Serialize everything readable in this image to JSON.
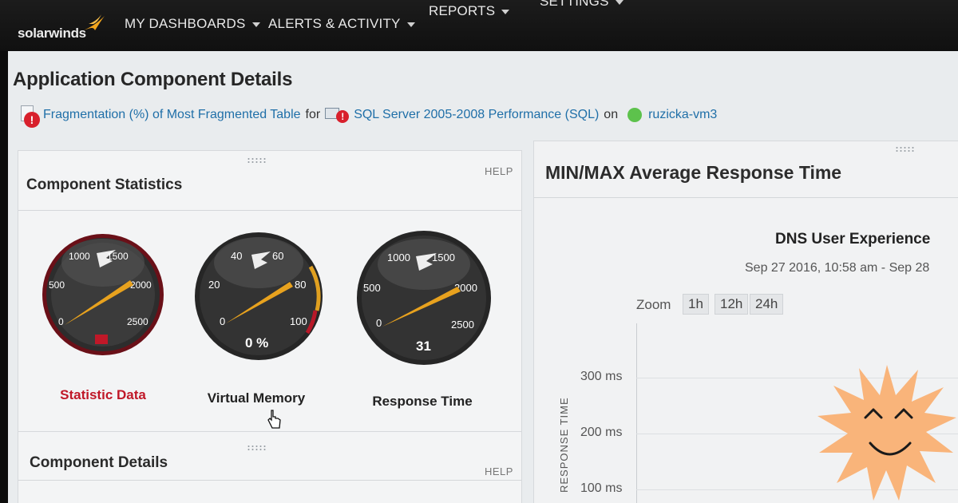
{
  "nav": {
    "brand": "solarwinds",
    "items": [
      {
        "label": "MY DASHBOARDS"
      },
      {
        "label": "ALERTS & ACTIVITY"
      },
      {
        "label": "REPORTS"
      },
      {
        "label": "SETTINGS"
      }
    ]
  },
  "page": {
    "title": "Application Component Details",
    "breadcrumb": {
      "component": "Fragmentation (%) of Most Fragmented Table",
      "for": "for",
      "application": "SQL Server 2005-2008 Performance (SQL)",
      "on": "on",
      "node": "ruzicka-vm3"
    }
  },
  "component_statistics": {
    "title": "Component Statistics",
    "help": "HELP",
    "gauges": [
      {
        "label": "Statistic Data",
        "ticks": [
          "0",
          "500",
          "1000",
          "1500",
          "2000",
          "2500"
        ],
        "value_text": "",
        "status": "critical"
      },
      {
        "label": "Virtual Memory",
        "ticks": [
          "0",
          "20",
          "40",
          "60",
          "80",
          "100"
        ],
        "value_text": "0 %",
        "status": "normal"
      },
      {
        "label": "Response Time",
        "ticks": [
          "0",
          "500",
          "1000",
          "1500",
          "2000",
          "2500"
        ],
        "value_text": "31",
        "status": "normal"
      }
    ]
  },
  "component_details": {
    "title": "Component Details",
    "help": "HELP"
  },
  "response_chart": {
    "title": "MIN/MAX Average Response Time",
    "subtitle": "DNS User Experience",
    "range": "Sep 27 2016, 10:58 am - Sep 28",
    "zoom_label": "Zoom",
    "zoom_options": [
      "1h",
      "12h",
      "24h"
    ],
    "y_axis_title": "RESPONSE TIME",
    "y_ticks": [
      "300 ms",
      "200 ms",
      "100 ms"
    ]
  },
  "colors": {
    "link": "#1f6fa8",
    "critical": "#c01828",
    "node_up": "#5dc24c",
    "needle": "#e8a21e",
    "brand_flame": "#f2a51c"
  }
}
